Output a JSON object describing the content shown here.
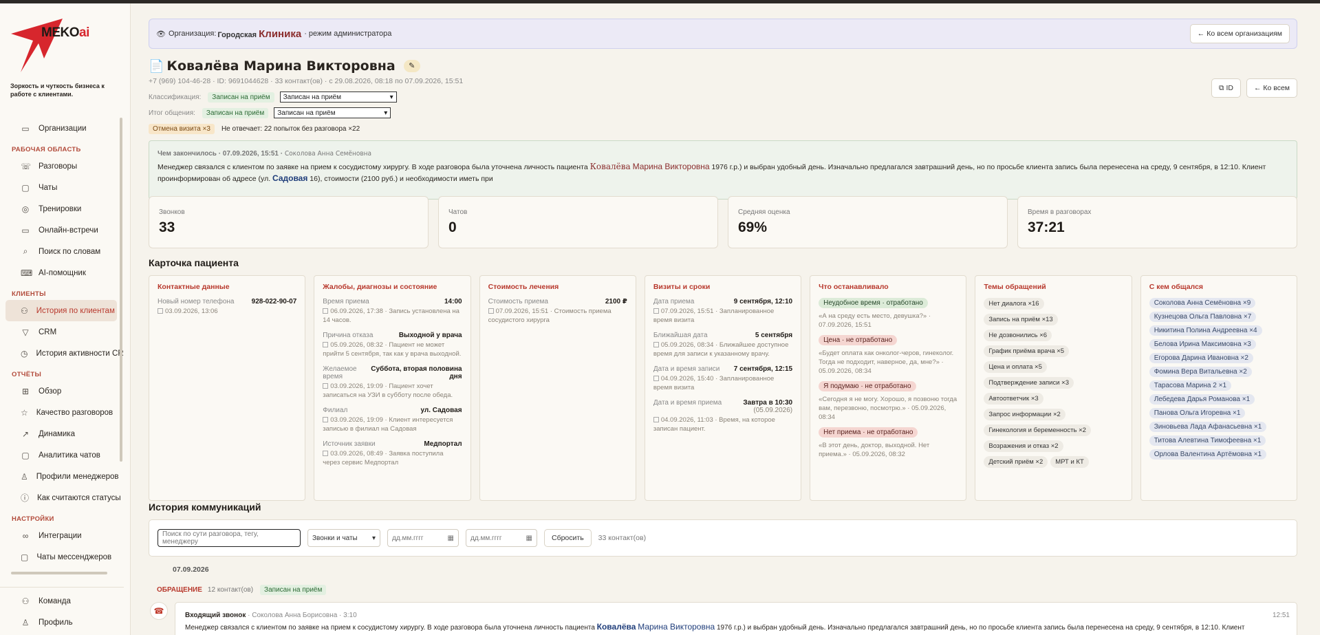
{
  "brand": {
    "logo_text": "MEKO",
    "logo_ai": "ai",
    "tagline": "Зоркость и чуткость бизнеса к работе с клиентами."
  },
  "sidebar": {
    "top": [
      {
        "label": "Организации",
        "icon": "folder-icon"
      }
    ],
    "work_section": "РАБОЧАЯ ОБЛАСТЬ",
    "work": [
      {
        "label": "Разговоры",
        "icon": "phone-icon"
      },
      {
        "label": "Чаты",
        "icon": "chat-icon"
      },
      {
        "label": "Тренировки",
        "icon": "training-icon"
      },
      {
        "label": "Онлайн-встречи",
        "icon": "video-icon"
      },
      {
        "label": "Поиск по словам",
        "icon": "search-icon"
      },
      {
        "label": "AI-помощник",
        "icon": "assistant-icon"
      }
    ],
    "clients_section": "КЛИЕНТЫ",
    "clients": [
      {
        "label": "История по клиентам",
        "icon": "users-icon",
        "active": true
      },
      {
        "label": "CRM",
        "icon": "filter-icon"
      },
      {
        "label": "История активности CRM",
        "icon": "history-icon"
      }
    ],
    "reports_section": "ОТЧЁТЫ",
    "reports": [
      {
        "label": "Обзор",
        "icon": "grid-icon"
      },
      {
        "label": "Качество разговоров",
        "icon": "star-icon"
      },
      {
        "label": "Динамика",
        "icon": "chart-icon"
      },
      {
        "label": "Аналитика чатов",
        "icon": "chat-icon"
      },
      {
        "label": "Профили менеджеров",
        "icon": "user-icon"
      },
      {
        "label": "Как считаются статусы",
        "icon": "help-icon"
      }
    ],
    "settings_section": "НАСТРОЙКИ",
    "settings": [
      {
        "label": "Интеграции",
        "icon": "link-icon"
      },
      {
        "label": "Чаты мессенджеров",
        "icon": "chat-icon"
      }
    ],
    "bottom": [
      {
        "label": "Команда",
        "icon": "team-icon"
      },
      {
        "label": "Профиль",
        "icon": "user-icon"
      }
    ]
  },
  "banner": {
    "prefix": "Организация:",
    "org_small": "Городская",
    "org_big": "Клиника",
    "suffix": "· режим администратора",
    "back_btn": "← Ко всем организациям"
  },
  "patient": {
    "name": "Ковалёва Марина Викторовна",
    "meta": "+7 (969) 104-46-28 · ID: 9691044628 · 33 контакт(ов) · с 29.08.2026, 08:18 по 07.09.2026, 15:51",
    "classification_label": "Классификация:",
    "classification_tag": "Записан на приём",
    "classification_value": "Записан на приём",
    "result_label": "Итог общения:",
    "result_tag": "Записан на приём",
    "result_value": "Записан на приём",
    "status_tag": "Отмена визита ×3",
    "status_text": "Не отвечает: 22 попыток без разговора ×22",
    "id_btn": "ID",
    "back_btn": "← Ко всем"
  },
  "summary": {
    "head": "Чем закончилось · 07.09.2026, 15:51 ·",
    "manager": "Соколова Анна Семёновна",
    "text_1": "Менеджер связался с клиентом по заявке на прием к сосудистому хирургу. В ходе разговора была уточнена личность пациента",
    "name_hl1": "Ковалёва",
    "name_hl2": "Марина Викторовна",
    "text_2": "1976 г.р.) и выбран удобный день. Изначально предлагался завтрашний день, но по просьбе клиента запись была перенесена на среду, 9 сентября, в 12:10. Клиент",
    "text_3": "проинформирован об адресе (ул.",
    "street": "Садовая",
    "text_4": "16), стоимости (2100 руб.) и необходимости иметь при"
  },
  "stats": [
    {
      "label": "Звонков",
      "value": "33"
    },
    {
      "label": "Чатов",
      "value": "0"
    },
    {
      "label": "Средняя оценка",
      "value": "69%"
    },
    {
      "label": "Время в разговорах",
      "value": "37:21"
    }
  ],
  "card_title": "Карточка пациента",
  "cards": {
    "contacts": {
      "title": "Контактные данные",
      "k1": "Новый номер телефона",
      "v1": "928-022-90-07",
      "n1": "03.09.2026, 13:06"
    },
    "complaints": {
      "title": "Жалобы, диагнозы и состояние",
      "rows": [
        {
          "k": "Время приема",
          "v": "14:00",
          "n": "06.09.2026, 17:38 · Запись установлена на 14 часов."
        },
        {
          "k": "Причина отказа",
          "v": "Выходной у врача",
          "n": "05.09.2026, 08:32 · Пациент не может прийти 5 сентября, так как у врача выходной."
        },
        {
          "k": "Желаемое время",
          "v": "Суббота, вторая половина дня",
          "n": "03.09.2026, 19:09 · Пациент хочет записаться на УЗИ в субботу после обеда."
        },
        {
          "k": "Филиал",
          "v": "ул. Садовая",
          "n": "03.09.2026, 19:09 · Клиент интересуется записью в филиал на Садовая"
        },
        {
          "k": "Источник заявки",
          "v": "Медпортал",
          "n": "03.09.2026, 08:49 · Заявка поступила через сервис Медпортал"
        }
      ]
    },
    "cost": {
      "title": "Стоимость лечения",
      "k1": "Стоимость приема",
      "v1": "2100 ₽",
      "n1": "07.09.2026, 15:51 · Стоимость приема сосудистого хирурга"
    },
    "visits": {
      "title": "Визиты и сроки",
      "rows": [
        {
          "k": "Дата приема",
          "v": "9 сентября, 12:10",
          "n": "07.09.2026, 15:51 · Запланированное время визита"
        },
        {
          "k": "Ближайшая дата",
          "v": "5 сентября",
          "n": "05.09.2026, 08:34 · Ближайшее доступное время для записи к указанному врачу."
        },
        {
          "k": "Дата и время записи",
          "v": "7 сентября, 12:15",
          "n": "04.09.2026, 15:40 · Запланированное время визита"
        },
        {
          "k": "Дата и время приема",
          "v": "Завтра в 10:30",
          "v2": "(05.09.2026)",
          "n": "04.09.2026, 11:03 · Время, на которое записан пациент."
        }
      ]
    },
    "stoppers": {
      "title": "Что останавливало",
      "items": [
        {
          "tag": "Неудобное время · отработано",
          "kind": "g",
          "q": "«А на среду есть место, девушка?» · 07.09.2026, 15:51"
        },
        {
          "tag": "Цена · не отработано",
          "kind": "r",
          "q": "«Будет оплата как онколог-черов, гинеколог. Тогда не подходит, наверное, да, мне?» · 05.09.2026, 08:34"
        },
        {
          "tag": "Я подумаю · не отработано",
          "kind": "r",
          "q": "«Сегодня я не могу. Хорошо, я позвоню тогда вам, перезвоню, посмотрю.» · 05.09.2026, 08:34"
        },
        {
          "tag": "Нет приема · не отработано",
          "kind": "r",
          "q": "«В этот день, доктор, выходной. Нет приема.» · 05.09.2026, 08:32"
        }
      ]
    },
    "topics": {
      "title": "Темы обращений",
      "items": [
        "Нет диалога ×16",
        "Запись на приём ×13",
        "Не дозвонились ×6",
        "График приёма врача ×5",
        "Цена и оплата ×5",
        "Подтверждение записи ×3",
        "Автоответчик ×3",
        "Запрос информации ×2",
        "Гинекология и беременность ×2",
        "Возражения и отказ ×2",
        "Детский приём ×2",
        "МРТ и КТ"
      ]
    },
    "people": {
      "title": "С кем общался",
      "items": [
        "Соколова Анна Семёновна ×9",
        "Кузнецова Ольга Павловна ×7",
        "Никитина Полина Андреевна ×4",
        "Белова Ирина Максимовна ×3",
        "Егорова Дарина Ивановна ×2",
        "Фомина Вера Витальевна ×2",
        "Тарасова Марина 2 ×1",
        "Лебедева Дарья Романова ×1",
        "Панова Ольга Игоревна ×1",
        "Зиновьева Лада Афанасьевна ×1",
        "Титова Алевтина Тимофеевна ×1",
        "Орлова Валентина Артёмовна ×1"
      ]
    }
  },
  "history_title": "История коммуникаций",
  "filters": {
    "search_placeholder": "Поиск по сути разговора, тегу, менеджеру",
    "channel": "Звонки и чаты",
    "date_from": "дд.мм.гггг",
    "date_to": "дд.мм.гггг",
    "reset": "Сбросить",
    "count": "33 контакт(ов)"
  },
  "day": "07.09.2026",
  "appeal": {
    "title": "ОБРАЩЕНИЕ",
    "count": "12 контакт(ов)",
    "tag": "Записан на приём"
  },
  "call": {
    "title": "Входящий звонок",
    "manager": "· Соколова Анна Борисовна · 3:10",
    "time": "12:51",
    "text_1": "Менеджер связался с клиентом по заявке на прием к сосудистому хирургу. В ходе разговора была уточнена личность пациента",
    "name_hl1": "Ковалёва",
    "name_hl2": "Марина Викторовна",
    "text_2": "1976 г.р.) и выбран удобный день. Изначально предлагался завтрашний день, но по просьбе клиента запись была перенесена на среду, 9 сентября, в 12:10. Клиент"
  }
}
